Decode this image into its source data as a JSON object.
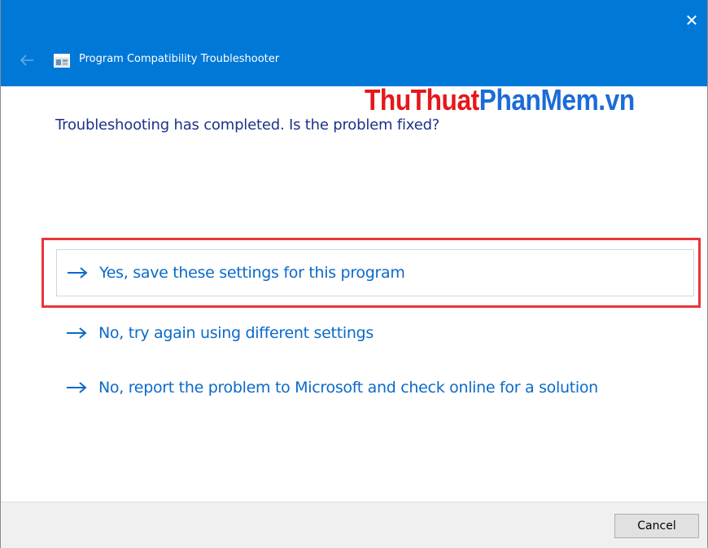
{
  "window": {
    "title": "Program Compatibility Troubleshooter",
    "close_glyph": "✕",
    "colors": {
      "titlebar": "#0078d7",
      "link": "#0b6ac9",
      "heading": "#1e3287",
      "highlight": "#e8363b"
    }
  },
  "watermark": {
    "part1": "ThuThuat",
    "part2": "PhanMem.vn"
  },
  "content": {
    "heading": "Troubleshooting has completed.  Is the problem fixed?",
    "options": [
      {
        "label": "Yes, save these settings for this program",
        "icon": "arrow-right-icon"
      },
      {
        "label": "No, try again using different settings",
        "icon": "arrow-right-icon"
      },
      {
        "label": "No, report the problem to Microsoft and check online for a solution",
        "icon": "arrow-right-icon"
      }
    ]
  },
  "footer": {
    "cancel_label": "Cancel"
  }
}
